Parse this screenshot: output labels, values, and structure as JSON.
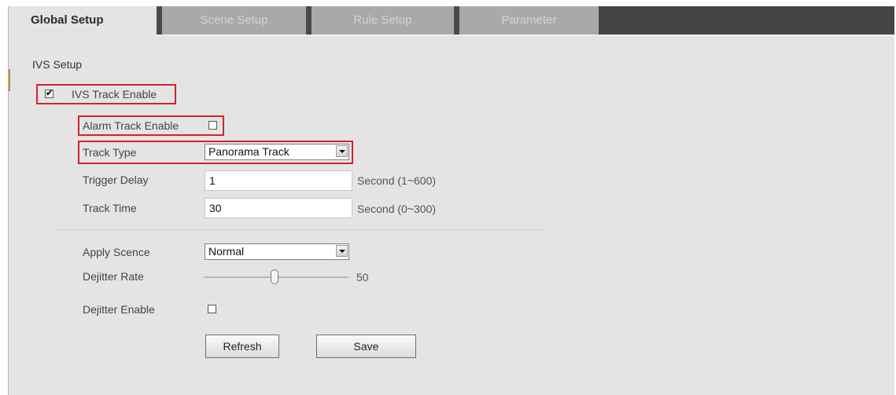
{
  "tabs": [
    {
      "label": "Global Setup",
      "active": true
    },
    {
      "label": "Scene Setup",
      "active": false
    },
    {
      "label": "Rule Setup",
      "active": false
    },
    {
      "label": "Parameter",
      "active": false
    }
  ],
  "section_title": "IVS Setup",
  "ivs_track_enable": {
    "label": "IVS Track Enable",
    "checked": true,
    "check_mark": "✔"
  },
  "alarm_track_enable": {
    "label": "Alarm Track Enable",
    "checked": false
  },
  "track_type": {
    "label": "Track Type",
    "value": "Panorama Track"
  },
  "trigger_delay": {
    "label": "Trigger Delay",
    "value": "1",
    "unit": "Second (1~600)"
  },
  "track_time": {
    "label": "Track Time",
    "value": "30",
    "unit": "Second (0~300)"
  },
  "apply_scene": {
    "label": "Apply Scence",
    "value": "Normal"
  },
  "dejitter_rate": {
    "label": "Dejitter Rate",
    "value": "50",
    "fraction": 0.5
  },
  "dejitter_enable": {
    "label": "Dejitter Enable",
    "checked": false
  },
  "buttons": {
    "refresh": "Refresh",
    "save": "Save"
  },
  "colors": {
    "highlight": "#d2232a",
    "panel": "#e4e4e4",
    "tab_inactive": "#a9a9a9",
    "tab_bar_dark": "#454545"
  },
  "icons": {
    "dropdown": "chevron-down-icon",
    "checkbox": "checkbox-icon"
  }
}
